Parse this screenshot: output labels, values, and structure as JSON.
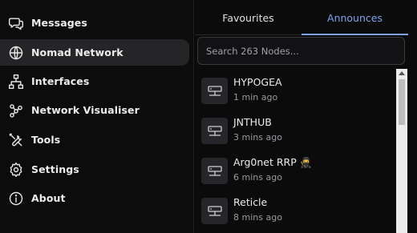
{
  "sidebar": {
    "items": [
      {
        "label": "Messages",
        "icon": "messages-icon",
        "active": false
      },
      {
        "label": "Nomad Network",
        "icon": "globe-icon",
        "active": true
      },
      {
        "label": "Interfaces",
        "icon": "network-tree-icon",
        "active": false
      },
      {
        "label": "Network Visualiser",
        "icon": "graph-nodes-icon",
        "active": false
      },
      {
        "label": "Tools",
        "icon": "tools-icon",
        "active": false
      },
      {
        "label": "Settings",
        "icon": "gear-icon",
        "active": false
      },
      {
        "label": "About",
        "icon": "info-icon",
        "active": false
      }
    ]
  },
  "tabs": {
    "favourites": "Favourites",
    "announces": "Announces",
    "active": "Announces",
    "active_color": "#7ea3e8"
  },
  "search": {
    "placeholder": "Search 263 Nodes...",
    "value": ""
  },
  "nodes": [
    {
      "name": "HYPOGEA",
      "time": "1 min ago",
      "icon": "server-icon"
    },
    {
      "name": "JNTHUB",
      "time": "3 mins ago",
      "icon": "server-icon"
    },
    {
      "name": "Arg0net RRP 🥷",
      "time": "6 mins ago",
      "icon": "server-icon"
    },
    {
      "name": "Reticle",
      "time": "8 mins ago",
      "icon": "server-icon"
    }
  ]
}
